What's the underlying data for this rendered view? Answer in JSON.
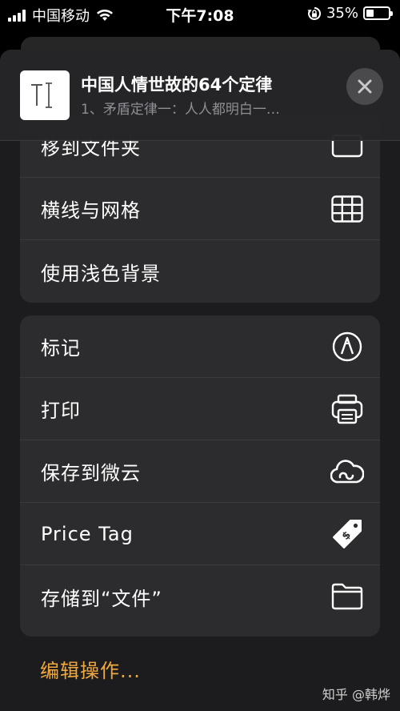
{
  "status_bar": {
    "carrier": "中国移动",
    "time": "下午7:08",
    "battery_percent_label": "35%",
    "battery_level": 0.35,
    "icons": [
      "signal-icon",
      "wifi-icon",
      "rotation-lock-icon",
      "battery-icon"
    ]
  },
  "share_header": {
    "title": "中国人情世故的64个定律",
    "subtitle": "1、矛盾定律一：人人都明白一…",
    "thumbnail_icon": "text-document-icon",
    "close_icon": "close-icon"
  },
  "menu_group_1": [
    {
      "label": "移到文件夹",
      "icon": "folder-move-icon"
    },
    {
      "label": "横线与网格",
      "icon": "grid-icon"
    },
    {
      "label": "使用浅色背景",
      "icon": ""
    }
  ],
  "menu_group_2": [
    {
      "label": "标记",
      "icon": "markup-pen-icon"
    },
    {
      "label": "打印",
      "icon": "printer-icon"
    },
    {
      "label": "保存到微云",
      "icon": "weiyun-cloud-icon"
    },
    {
      "label": "Price Tag",
      "icon": "price-tag-icon"
    },
    {
      "label": "存储到“文件”",
      "icon": "folder-icon"
    }
  ],
  "edit_actions_label": "编辑操作...",
  "watermark": "知乎 @韩烨",
  "colors": {
    "accent": "#f2a93b",
    "sheet": "#1c1c1e",
    "cell": "#2c2c2e"
  }
}
